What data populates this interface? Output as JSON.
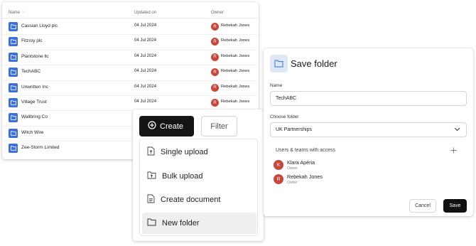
{
  "file_list": {
    "columns": {
      "name": "Name",
      "sort_indicator": "↑",
      "updated": "Updated on",
      "owner": "Owner"
    },
    "rows": [
      {
        "name": "Cassian Lloyd plc",
        "updated": "04 Jul 2024",
        "owner_initial": "R",
        "owner": "Rebekah Jones"
      },
      {
        "name": "Fitzroy plc",
        "updated": "04 Jul 2024",
        "owner_initial": "R",
        "owner": "Rebekah Jones"
      },
      {
        "name": "Plantstone llc",
        "updated": "04 Jul 2024",
        "owner_initial": "R",
        "owner": "Rebekah Jones"
      },
      {
        "name": "TechABC",
        "updated": "04 Jul 2024",
        "owner_initial": "R",
        "owner": "Rebekah Jones"
      },
      {
        "name": "Unwritten Inc",
        "updated": "04 Jul 2024",
        "owner_initial": "R",
        "owner": "Rebekah Jones"
      },
      {
        "name": "Village Trust",
        "updated": "04 Jul 2024",
        "owner_initial": "R",
        "owner": "Rebekah Jones"
      },
      {
        "name": "Wallbring Co",
        "updated": "",
        "owner_initial": "",
        "owner": ""
      },
      {
        "name": "Witch Wire",
        "updated": "",
        "owner_initial": "",
        "owner": ""
      },
      {
        "name": "Zee-Storm Limited",
        "updated": "",
        "owner_initial": "",
        "owner": ""
      }
    ],
    "folder_icon": "folder-icon",
    "folder_color": "#3b6fe0",
    "avatar_color": "#c9463a"
  },
  "create_menu": {
    "create_label": "Create",
    "create_icon": "plus-circle-icon",
    "filter_label": "Filter",
    "items": [
      {
        "label": "Single upload",
        "icon": "file-upload-icon",
        "active": false
      },
      {
        "label": "Bulk upload",
        "icon": "folder-upload-icon",
        "active": false
      },
      {
        "label": "Create document",
        "icon": "document-icon",
        "active": false
      },
      {
        "label": "New folder",
        "icon": "folder-icon",
        "active": true
      }
    ]
  },
  "save_dialog": {
    "title": "Save folder",
    "name_label": "Name",
    "name_value": "TechABC",
    "choose_label": "Choose folder",
    "choose_value": "UK Partnerships",
    "access_title": "Users & teams with access",
    "add_icon": "plus-icon",
    "users": [
      {
        "initial": "K",
        "name": "Klara Apéria",
        "role": "Owner"
      },
      {
        "initial": "R",
        "name": "Rebekah Jones",
        "role": "Owner"
      }
    ],
    "cancel_label": "Cancel",
    "save_label": "Save"
  }
}
